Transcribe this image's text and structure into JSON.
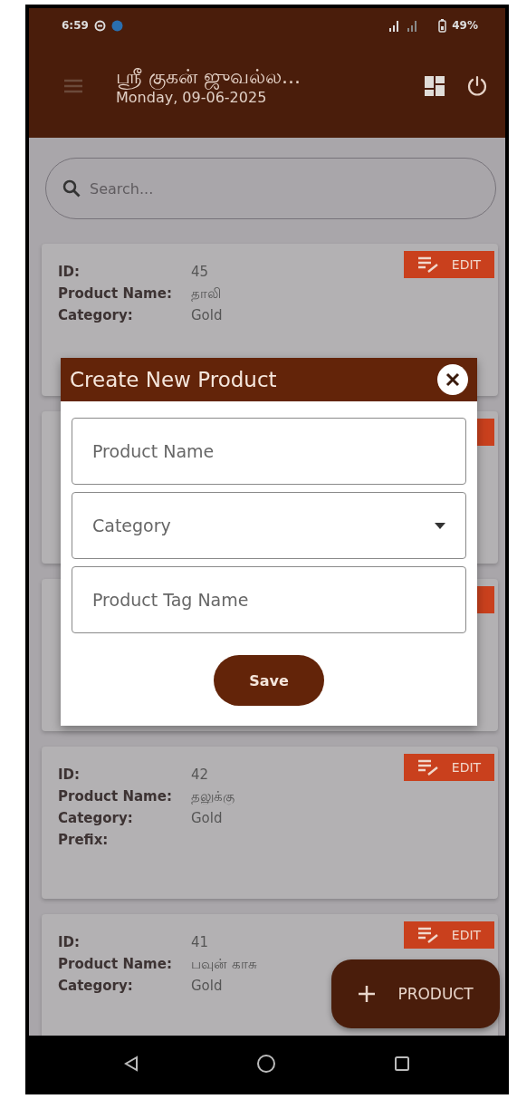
{
  "status_bar": {
    "time": "6:59",
    "battery": "49%"
  },
  "header": {
    "title": "ஸ்ரீ குகன் ஜுவல்ல...",
    "date": "Monday, 09-06-2025"
  },
  "search": {
    "placeholder": "Search..."
  },
  "cards": [
    {
      "kind": "product",
      "edit_label": "EDIT",
      "fields": [
        {
          "label": "ID:",
          "value": "45"
        },
        {
          "label": "Product Name:",
          "value": "தாலி"
        },
        {
          "label": "Category:",
          "value": "Gold"
        }
      ]
    },
    {
      "kind": "covered"
    },
    {
      "kind": "covered"
    },
    {
      "kind": "product",
      "edit_label": "EDIT",
      "fields": [
        {
          "label": "ID:",
          "value": "42"
        },
        {
          "label": "Product Name:",
          "value": "தலுக்கு"
        },
        {
          "label": "Category:",
          "value": "Gold"
        },
        {
          "label": "Prefix:"
        }
      ]
    },
    {
      "kind": "product",
      "edit_label": "EDIT",
      "fields": [
        {
          "label": "ID:",
          "value": "41"
        },
        {
          "label": "Product Name:",
          "value": "பவுன் காசு"
        },
        {
          "label": "Category:",
          "value": "Gold"
        }
      ]
    }
  ],
  "dialog": {
    "title": "Create New Product",
    "fields": [
      {
        "kind": "text",
        "placeholder": "Product Name"
      },
      {
        "kind": "select",
        "placeholder": "Category"
      },
      {
        "kind": "text",
        "placeholder": "Product Tag Name"
      }
    ],
    "save_label": "Save"
  },
  "fab": {
    "label": "PRODUCT"
  }
}
